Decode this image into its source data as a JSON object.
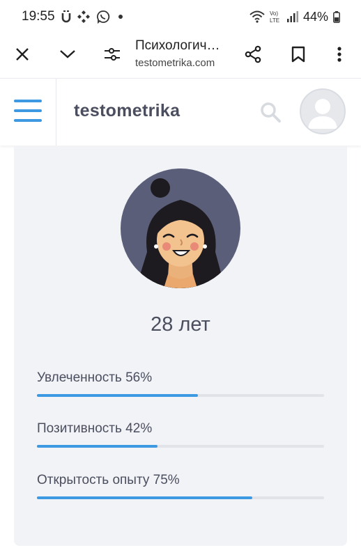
{
  "status_bar": {
    "time": "19:55",
    "battery": "44%",
    "icons": [
      "u-icon",
      "apps-icon",
      "viber-icon",
      "dot-icon",
      "wifi-icon",
      "volte-icon",
      "signal-icon",
      "battery-icon"
    ]
  },
  "browser": {
    "page_title": "Психологич…",
    "url": "testometrika.com",
    "icons": [
      "close-icon",
      "chevron-down-icon",
      "tune-icon",
      "share-icon",
      "bookmark-icon",
      "more-icon"
    ]
  },
  "site": {
    "logo": "testometrika",
    "accent_color": "#3d9ae2",
    "text_color": "#4b4e5e"
  },
  "result": {
    "age": "28 лет",
    "metrics": [
      {
        "label": "Увлеченность 56%",
        "value": 56
      },
      {
        "label": "Позитивность 42%",
        "value": 42
      },
      {
        "label": "Открытость опыту 75%",
        "value": 75
      }
    ]
  }
}
